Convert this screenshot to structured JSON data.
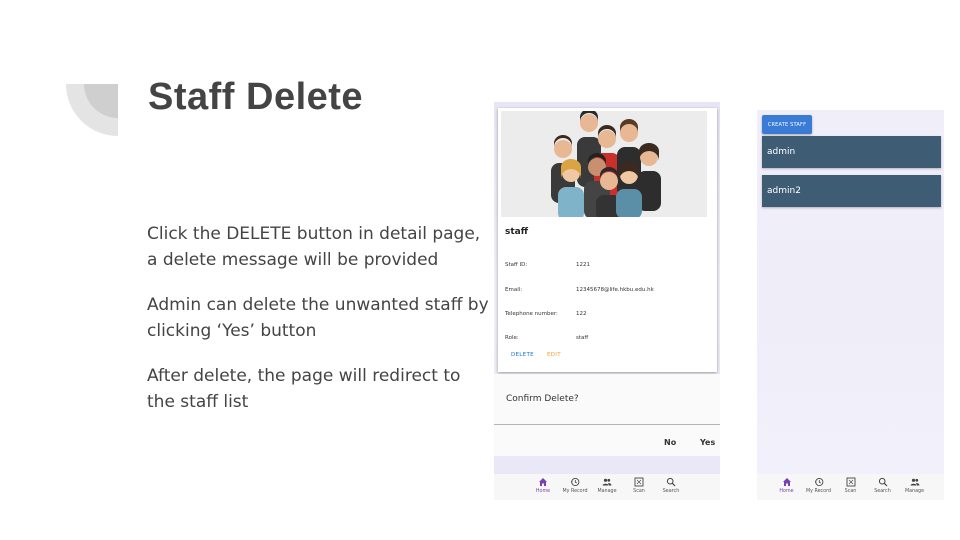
{
  "slide": {
    "title": "Staff Delete",
    "paragraphs": [
      "Click the DELETE  button in detail page, a delete message will be provided",
      "Admin can delete the unwanted staff by clicking ‘Yes’ button",
      "After delete, the page will redirect to the staff list"
    ]
  },
  "detail": {
    "name": "staff",
    "fields": [
      {
        "label": "Staff ID:",
        "value": "1221"
      },
      {
        "label": "Email:",
        "value": "12345678@life.hkbu.edu.hk"
      },
      {
        "label": "Telephone number:",
        "value": "122"
      },
      {
        "label": "Role:",
        "value": "staff"
      }
    ],
    "delete_label": "DELETE",
    "edit_label": "EDIT",
    "delete_color": "#1976d2",
    "edit_color": "#f0a030"
  },
  "dialog": {
    "message": "Confirm Delete?",
    "no_label": "No",
    "yes_label": "Yes"
  },
  "nav1": [
    {
      "icon": "home-icon",
      "label": "Home",
      "active": true
    },
    {
      "icon": "history-icon",
      "label": "My Record"
    },
    {
      "icon": "people-icon",
      "label": "Manage"
    },
    {
      "icon": "scan-icon",
      "label": "Scan"
    },
    {
      "icon": "search-icon",
      "label": "Search"
    }
  ],
  "list": {
    "create_label": "CREATE STAFF",
    "items": [
      "admin",
      "admin2"
    ]
  },
  "nav2": [
    {
      "icon": "home-icon",
      "label": "Home",
      "active": true
    },
    {
      "icon": "history-icon",
      "label": "My Record"
    },
    {
      "icon": "scan-icon",
      "label": "Scan"
    },
    {
      "icon": "search-icon",
      "label": "Search"
    },
    {
      "icon": "people-icon",
      "label": "Manage"
    }
  ],
  "colors": {
    "title": "#444444",
    "accent_purple": "#7b3fb5",
    "list_item": "#3e5d74",
    "create_button": "#3a7bd5"
  }
}
